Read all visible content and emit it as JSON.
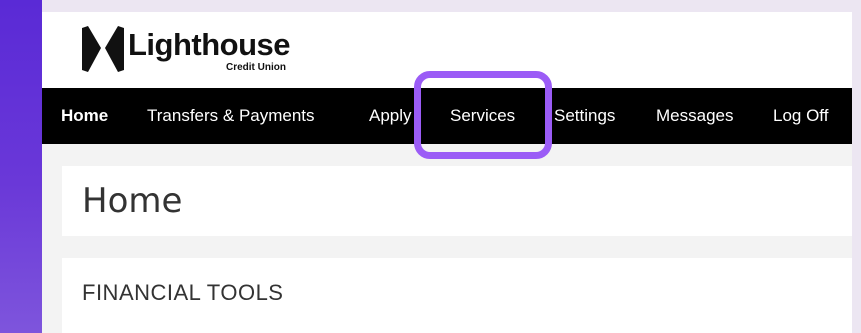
{
  "brand": {
    "name": "Lighthouse",
    "subtitle": "Credit Union"
  },
  "nav": {
    "items": [
      {
        "label": "Home"
      },
      {
        "label": "Transfers & Payments"
      },
      {
        "label": "Apply"
      },
      {
        "label": "Services"
      },
      {
        "label": "Settings"
      },
      {
        "label": "Messages"
      },
      {
        "label": "Log Off"
      }
    ],
    "active": "Home",
    "highlighted": "Services"
  },
  "page": {
    "title": "Home"
  },
  "sections": {
    "financial_tools": "FINANCIAL TOOLS"
  },
  "colors": {
    "nav_background": "#000000",
    "highlight_outline": "#9b5cf6",
    "left_strip": "#5a2ad6"
  },
  "icons": {
    "logo": "lighthouse-logo-icon"
  }
}
